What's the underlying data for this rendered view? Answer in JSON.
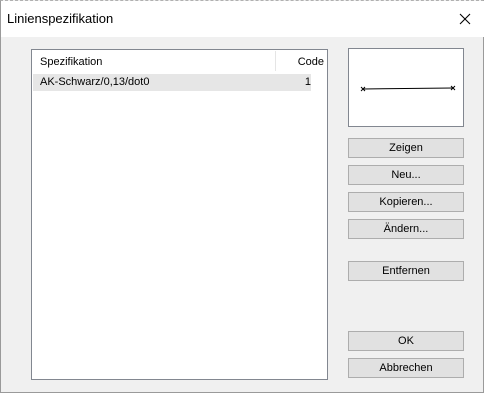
{
  "window": {
    "title": "Linienspezifikation"
  },
  "list": {
    "columns": [
      "Spezifikation",
      "Code"
    ],
    "rows": [
      {
        "spezifikation": "AK-Schwarz/0,13/dot0",
        "code": "1"
      }
    ]
  },
  "buttons": {
    "zeigen": "Zeigen",
    "neu": "Neu...",
    "kopieren": "Kopieren...",
    "aendern": "Ändern...",
    "entfernen": "Entfernen",
    "ok": "OK",
    "abbrechen": "Abbrechen"
  },
  "icons": {
    "close": "close-icon"
  }
}
